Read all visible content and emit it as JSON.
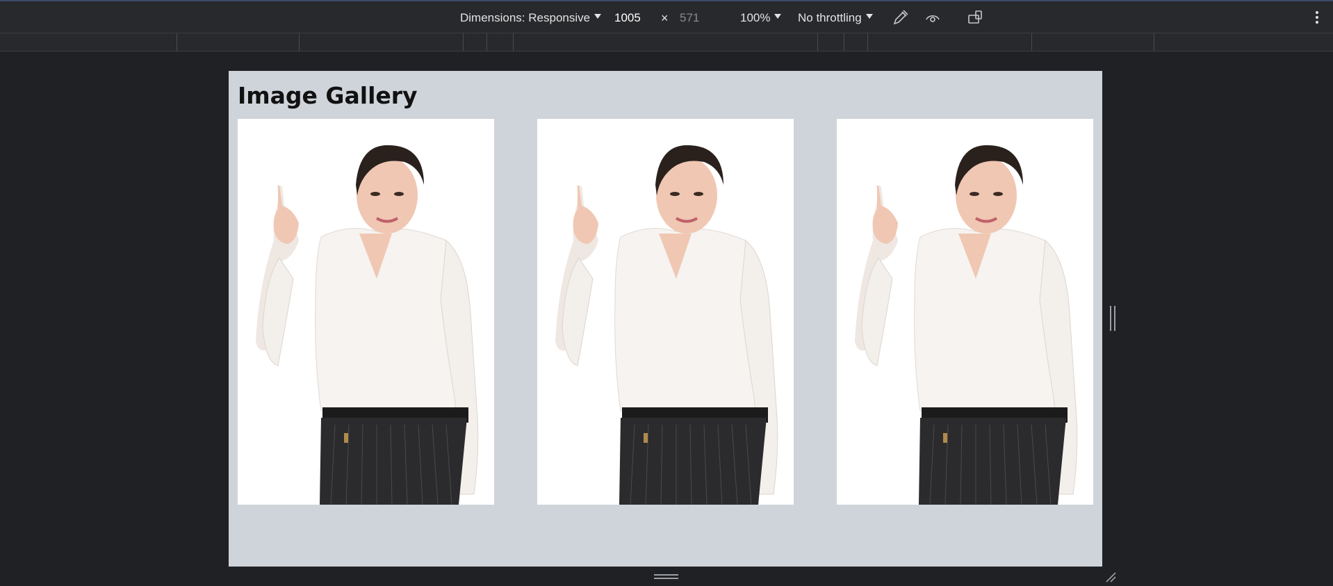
{
  "devtools": {
    "dimensions_label": "Dimensions: Responsive",
    "width_value": "1005",
    "times_symbol": "×",
    "height_value": "571",
    "zoom_label": "100%",
    "throttling_label": "No throttling",
    "icons": [
      "color-picker-icon",
      "vision-deficiency-icon",
      "rotate-device-icon",
      "more-options-icon"
    ]
  },
  "page": {
    "title": "Image Gallery",
    "background_color": "#cfd3da"
  },
  "gallery": {
    "items": [
      {
        "alt": "Woman in white blouse pointing up"
      },
      {
        "alt": "Woman in white blouse pointing up"
      },
      {
        "alt": "Woman in white blouse pointing up"
      }
    ]
  }
}
